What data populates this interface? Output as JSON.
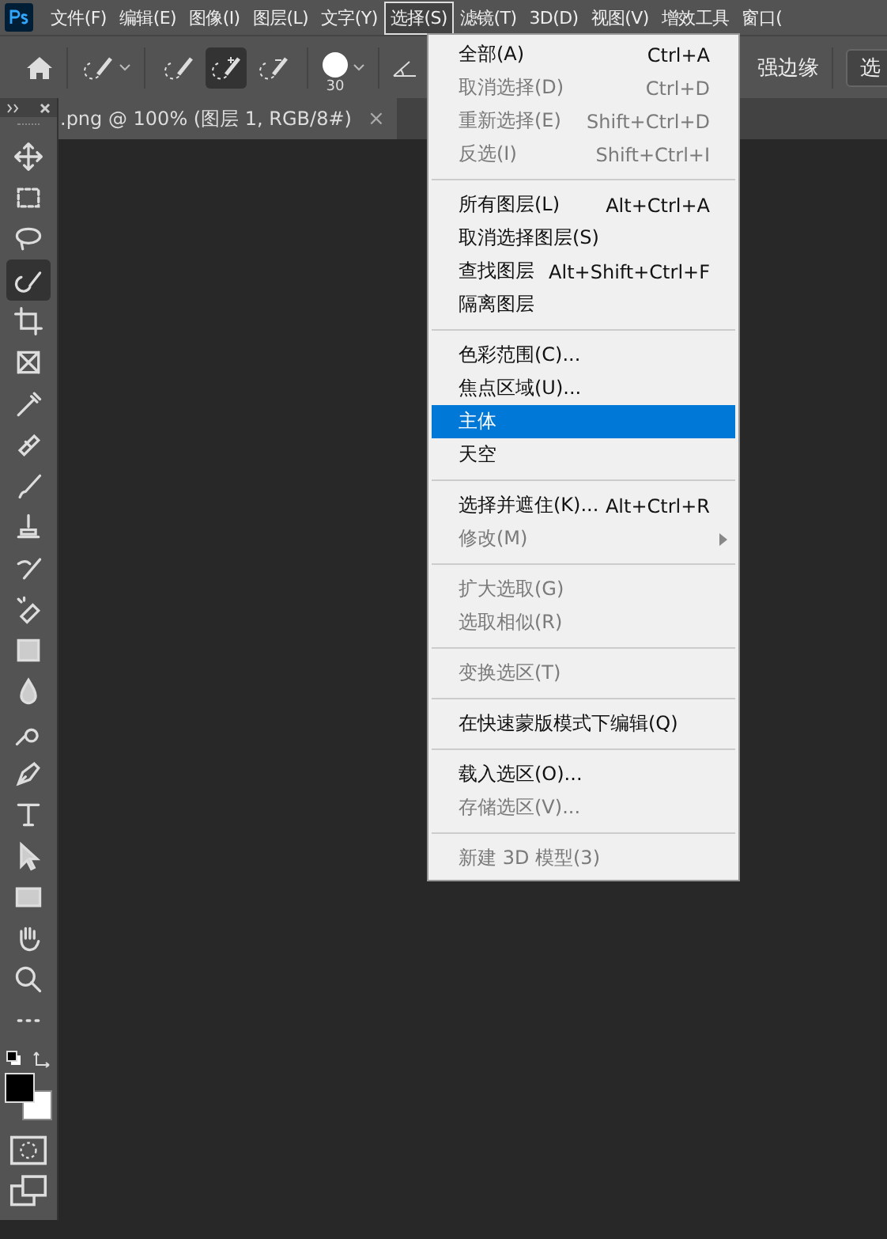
{
  "menubar": [
    {
      "label": "文件(F)",
      "selected": false
    },
    {
      "label": "编辑(E)",
      "selected": false
    },
    {
      "label": "图像(I)",
      "selected": false
    },
    {
      "label": "图层(L)",
      "selected": false
    },
    {
      "label": "文字(Y)",
      "selected": false
    },
    {
      "label": "选择(S)",
      "selected": true
    },
    {
      "label": "滤镜(T)",
      "selected": false
    },
    {
      "label": "3D(D)",
      "selected": false
    },
    {
      "label": "视图(V)",
      "selected": false
    },
    {
      "label": "增效工具",
      "selected": false
    },
    {
      "label": "窗口(",
      "selected": false
    }
  ],
  "options_bar": {
    "modes": [
      {
        "selected": false
      },
      {
        "selected": true
      },
      {
        "selected": false
      }
    ],
    "brush_size": "30",
    "refine_label": "强边缘",
    "select_button": "选"
  },
  "document_tab": {
    "title": ".png @ 100% (图层 1, RGB/8#)",
    "close": "×"
  },
  "tools": [
    {
      "selected": false
    },
    {
      "selected": false
    },
    {
      "selected": false
    },
    {
      "selected": true
    },
    {
      "selected": false
    },
    {
      "selected": false
    },
    {
      "selected": false
    },
    {
      "selected": false
    },
    {
      "selected": false
    },
    {
      "selected": false
    },
    {
      "selected": false
    },
    {
      "selected": false
    },
    {
      "selected": false
    },
    {
      "selected": false
    },
    {
      "selected": false
    },
    {
      "selected": false
    },
    {
      "selected": false
    },
    {
      "selected": false
    },
    {
      "selected": false
    },
    {
      "selected": false
    },
    {
      "selected": false
    },
    {
      "selected": false
    }
  ],
  "menu": [
    {
      "kind": "item",
      "label": "全部(A)",
      "shortcut": "Ctrl+A",
      "disabled": false,
      "selected": false
    },
    {
      "kind": "item",
      "label": "取消选择(D)",
      "shortcut": "Ctrl+D",
      "disabled": true,
      "selected": false
    },
    {
      "kind": "item",
      "label": "重新选择(E)",
      "shortcut": "Shift+Ctrl+D",
      "disabled": true,
      "selected": false
    },
    {
      "kind": "item",
      "label": "反选(I)",
      "shortcut": "Shift+Ctrl+I",
      "disabled": true,
      "selected": false
    },
    {
      "kind": "separator"
    },
    {
      "kind": "item",
      "label": "所有图层(L)",
      "shortcut": "Alt+Ctrl+A",
      "disabled": false,
      "selected": false
    },
    {
      "kind": "item",
      "label": "取消选择图层(S)",
      "disabled": false,
      "selected": false
    },
    {
      "kind": "item",
      "label": "查找图层",
      "shortcut": "Alt+Shift+Ctrl+F",
      "disabled": false,
      "selected": false
    },
    {
      "kind": "item",
      "label": "隔离图层",
      "disabled": false,
      "selected": false
    },
    {
      "kind": "separator"
    },
    {
      "kind": "item",
      "label": "色彩范围(C)...",
      "disabled": false,
      "selected": false
    },
    {
      "kind": "item",
      "label": "焦点区域(U)...",
      "disabled": false,
      "selected": false
    },
    {
      "kind": "item",
      "label": "主体",
      "disabled": false,
      "selected": true
    },
    {
      "kind": "item",
      "label": "天空",
      "disabled": false,
      "selected": false
    },
    {
      "kind": "separator"
    },
    {
      "kind": "item",
      "label": "选择并遮住(K)...",
      "shortcut": "Alt+Ctrl+R",
      "disabled": false,
      "selected": false
    },
    {
      "kind": "submenu",
      "label": "修改(M)",
      "disabled": true,
      "selected": false
    },
    {
      "kind": "separator"
    },
    {
      "kind": "item",
      "label": "扩大选取(G)",
      "disabled": true,
      "selected": false
    },
    {
      "kind": "item",
      "label": "选取相似(R)",
      "disabled": true,
      "selected": false
    },
    {
      "kind": "separator"
    },
    {
      "kind": "item",
      "label": "变换选区(T)",
      "disabled": true,
      "selected": false
    },
    {
      "kind": "separator"
    },
    {
      "kind": "item",
      "label": "在快速蒙版模式下编辑(Q)",
      "disabled": false,
      "selected": false
    },
    {
      "kind": "separator"
    },
    {
      "kind": "item",
      "label": "载入选区(O)...",
      "disabled": false,
      "selected": false
    },
    {
      "kind": "item",
      "label": "存储选区(V)...",
      "disabled": true,
      "selected": false
    },
    {
      "kind": "separator"
    },
    {
      "kind": "item",
      "label": "新建 3D 模型(3)",
      "disabled": true,
      "selected": false
    }
  ]
}
